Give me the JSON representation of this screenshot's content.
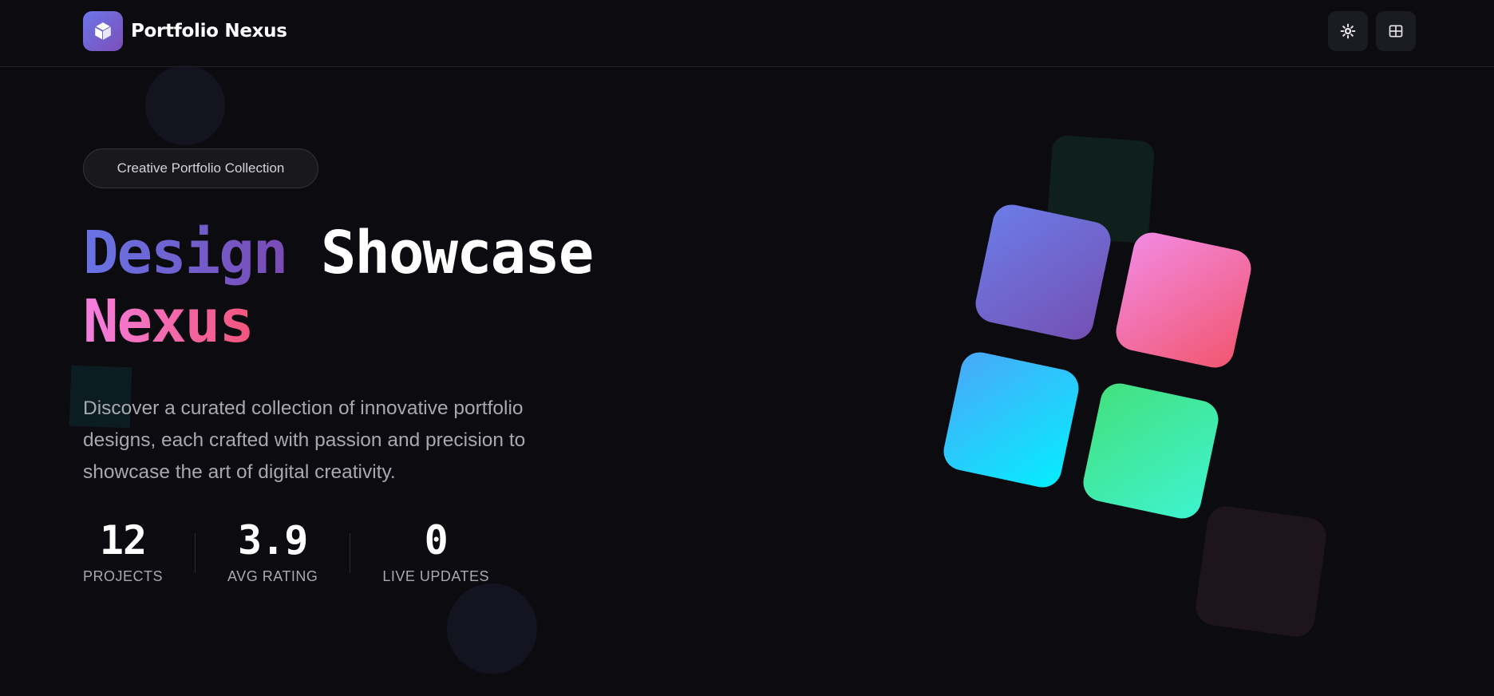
{
  "header": {
    "brand": "Portfolio Nexus",
    "logo_icon": "cube-icon",
    "theme_button_icon": "sun-gear-icon",
    "layout_button_icon": "grid-icon"
  },
  "hero": {
    "badge": "Creative Portfolio Collection",
    "title_word_1": "Design",
    "title_word_2": "Showcase",
    "title_word_3": "Nexus",
    "description": "Discover a curated collection of innovative portfolio designs, each crafted with passion and precision to showcase the art of digital creativity."
  },
  "stats": [
    {
      "value": "12",
      "label": "PROJECTS"
    },
    {
      "value": "3.9",
      "label": "AVG RATING"
    },
    {
      "value": "0",
      "label": "LIVE UPDATES"
    }
  ],
  "colors": {
    "background": "#0b0b10",
    "accent_purple": "#6b7ce8",
    "accent_pink": "#f28ae3",
    "accent_blue": "#4aa8f8",
    "accent_green": "#43e07d"
  }
}
